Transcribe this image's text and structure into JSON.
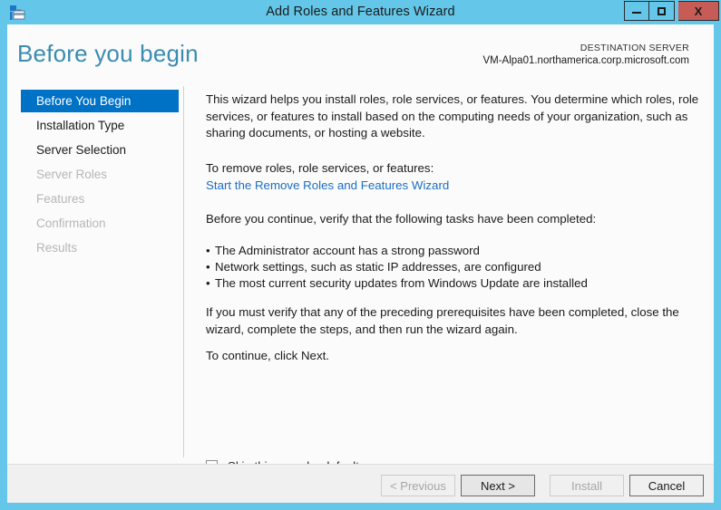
{
  "window": {
    "title": "Add Roles and Features Wizard",
    "icon": "server-roles-icon",
    "controls": {
      "minimize": "minimize-icon",
      "maximize": "maximize-icon",
      "close": "X"
    }
  },
  "header": {
    "page_title": "Before you begin",
    "destination_label": "DESTINATION SERVER",
    "destination_value": "VM-Alpa01.northamerica.corp.microsoft.com"
  },
  "nav": {
    "items": [
      {
        "label": "Before You Begin",
        "state": "selected"
      },
      {
        "label": "Installation Type",
        "state": "enabled"
      },
      {
        "label": "Server Selection",
        "state": "enabled"
      },
      {
        "label": "Server Roles",
        "state": "disabled"
      },
      {
        "label": "Features",
        "state": "disabled"
      },
      {
        "label": "Confirmation",
        "state": "disabled"
      },
      {
        "label": "Results",
        "state": "disabled"
      }
    ]
  },
  "content": {
    "intro": "This wizard helps you install roles, role services, or features. You determine which roles, role services, or features to install based on the computing needs of your organization, such as sharing documents, or hosting a website.",
    "remove_prompt": "To remove roles, role services, or features:",
    "remove_link": "Start the Remove Roles and Features Wizard",
    "verify_prompt": "Before you continue, verify that the following tasks have been completed:",
    "bullet_char": "•",
    "tasks": [
      "The Administrator account has a strong password",
      "Network settings, such as static IP addresses, are configured",
      "The most current security updates from Windows Update are installed"
    ],
    "prereq_note": "If you must verify that any of the preceding prerequisites have been completed, close the wizard, complete the steps, and then run the wizard again.",
    "continue_note": "To continue, click Next.",
    "skip_checkbox_label": "Skip this page by default",
    "skip_checkbox_checked": false
  },
  "footer": {
    "buttons": [
      {
        "label": "< Previous",
        "state": "disabled"
      },
      {
        "label": "Next >",
        "state": "default"
      },
      {
        "label": "Install",
        "state": "disabled"
      },
      {
        "label": "Cancel",
        "state": "enabled"
      }
    ]
  },
  "colors": {
    "window_frame": "#64c6e8",
    "accent_selected": "#0072c6",
    "heading": "#3b8cb0",
    "link": "#1b6ec2",
    "close_button": "#c75b55",
    "client_bg": "#fbfbfb",
    "footer_bg": "#f0f0f0",
    "disabled_text": "#b6b6b6"
  }
}
